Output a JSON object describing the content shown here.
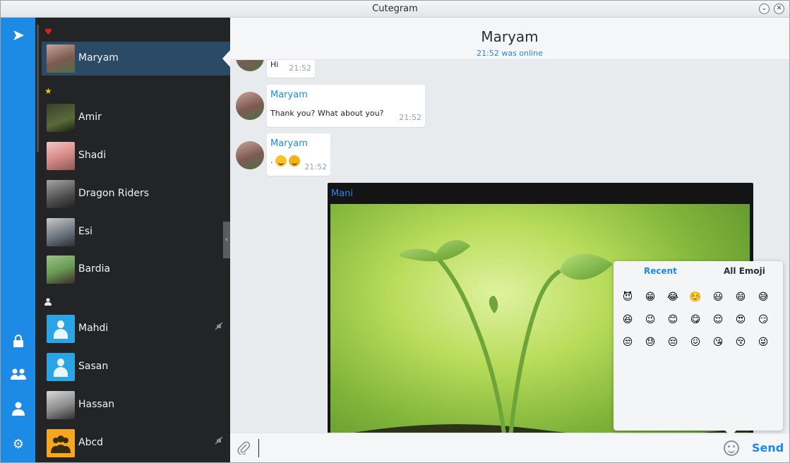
{
  "window": {
    "title": "Cutegram"
  },
  "rail": {
    "icons": [
      "telegram-logo-icon",
      "lock-icon",
      "group-icon",
      "profile-icon",
      "settings-icon"
    ]
  },
  "sidebar": {
    "groups": [
      {
        "icon": "heart-icon",
        "color": "#e02020",
        "glyph": "♥"
      },
      {
        "icon": "star-icon",
        "color": "#f2c21b",
        "glyph": "★"
      },
      {
        "icon": "person-icon",
        "color": "#e6e6e6",
        "glyph": "👤"
      }
    ],
    "contacts": [
      {
        "name": "Maryam",
        "active": true
      },
      {
        "name": "Amir"
      },
      {
        "name": "Shadi"
      },
      {
        "name": "Dragon Riders"
      },
      {
        "name": "Esi"
      },
      {
        "name": "Bardia"
      },
      {
        "name": "Mahdi",
        "muted": true
      },
      {
        "name": "Sasan"
      },
      {
        "name": "Hassan"
      },
      {
        "name": "Abcd",
        "muted": true
      }
    ]
  },
  "chat": {
    "peer_name": "Maryam",
    "peer_status": "21:52 was online",
    "messages": [
      {
        "text": "Hi",
        "time": "21:52"
      },
      {
        "sender": "Maryam",
        "text": "Thank you? What about you?",
        "time": "21:52"
      },
      {
        "sender": "Maryam",
        "text": ".",
        "emojis": [
          "grinning-face-emoji",
          "winking-tongue-emoji"
        ],
        "time": "21:52"
      }
    ],
    "media": {
      "sender": "Mani",
      "content": "photo"
    }
  },
  "composer": {
    "input_value": "",
    "send_label": "Send"
  },
  "emoji_panel": {
    "tabs": [
      "Recent",
      "All Emoji"
    ],
    "active_tab": "Recent",
    "emojis": [
      "😈",
      "😁",
      "😂",
      "☺️",
      "😃",
      "😄",
      "😅",
      "😆",
      "😉",
      "😊",
      "😋",
      "😌",
      "😍",
      "😏",
      "😒",
      "😓",
      "😔",
      "😖",
      "😘",
      "😚",
      "😜"
    ]
  }
}
